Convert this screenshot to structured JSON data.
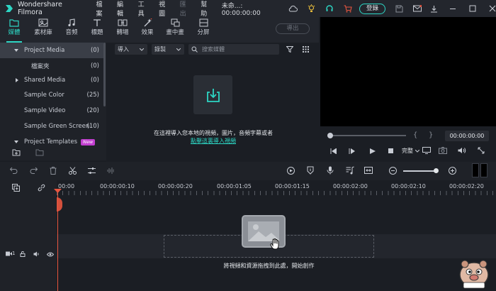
{
  "app": {
    "title": "Wondershare Filmora"
  },
  "menu": {
    "items": [
      "檔案",
      "編輯",
      "工具",
      "視圖",
      "匯出",
      "幫助"
    ],
    "project_time": "未命...: 00:00:00:00"
  },
  "header": {
    "login_label": "登錄"
  },
  "tabs": [
    {
      "label": "媒體"
    },
    {
      "label": "素材庫"
    },
    {
      "label": "音频"
    },
    {
      "label": "標題"
    },
    {
      "label": "轉場"
    },
    {
      "label": "效果"
    },
    {
      "label": "畫中畫"
    },
    {
      "label": "分屏"
    }
  ],
  "export_label": "導出",
  "sidebar": {
    "items": [
      {
        "label": "Project Media",
        "count": "(0)"
      },
      {
        "label": "檔案夾",
        "count": "(0)"
      },
      {
        "label": "Shared Media",
        "count": "(0)"
      },
      {
        "label": "Sample Color",
        "count": "(25)"
      },
      {
        "label": "Sample Video",
        "count": "(20)"
      },
      {
        "label": "Sample Green Screen",
        "count": "(10)"
      },
      {
        "label": "Project Templates",
        "badge": "New"
      }
    ]
  },
  "media": {
    "import_label": "導入",
    "record_label": "錄製",
    "search_placeholder": "搜索媒體",
    "empty_text": "在這裡導入您本地的視頻，圖片，音頻字幕或者",
    "empty_link": "點擊這裏導入視頻"
  },
  "preview": {
    "bracket_left": "{",
    "bracket_right": "}",
    "timecode": "00:00:00:00",
    "quality_label": "完整"
  },
  "timeline": {
    "ruler_labels": [
      "00:00",
      "00:00:00:10",
      "00:00:00:20",
      "00:00:01:05",
      "00:00:01:15",
      "00:00:02:00",
      "00:00:02:10",
      "00:00:02:20"
    ],
    "drop_text": "將視頻和資源拖拽到此處，開始創作",
    "track_number": "1"
  },
  "colors": {
    "accent": "#2dd6c4",
    "playhead": "#e8553f",
    "badge": "#c33fd1"
  }
}
